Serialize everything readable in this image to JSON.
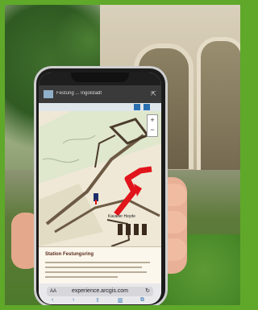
{
  "border_color": "#5fa82a",
  "phone": {
    "status_bar": {
      "time": "",
      "icons": ""
    },
    "app_header": {
      "title": "Festung ... Ingolstadt"
    },
    "map": {
      "route_color": "#e1141b",
      "label": "Kavalier Heyde"
    },
    "info_panel": {
      "title": "Station Festungsring"
    },
    "browser": {
      "aa_label": "AA",
      "url": "experience.arcgis.com",
      "reload_icon": "reload-icon",
      "nav_icons": [
        "back-icon",
        "forward-icon",
        "share-icon",
        "bookmarks-icon",
        "tabs-icon"
      ]
    }
  }
}
